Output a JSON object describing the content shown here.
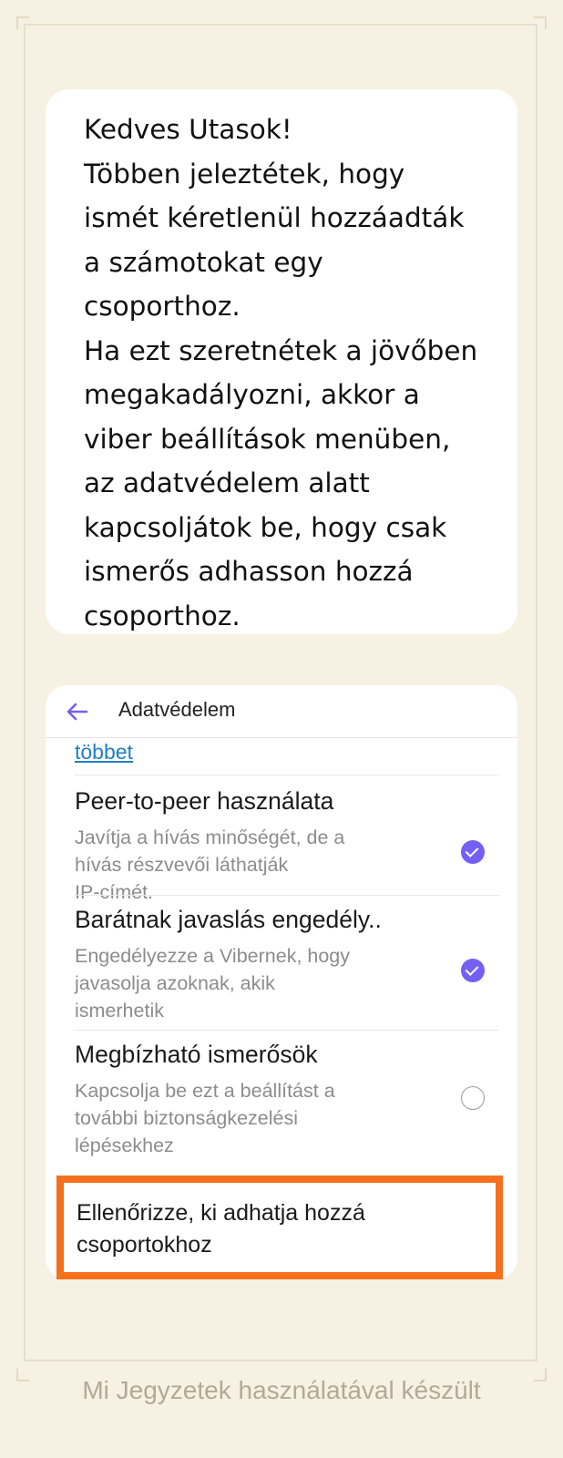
{
  "note": {
    "lines": [
      "Kedves Utasok!",
      "Többen jeleztétek, hogy",
      "ismét kéretlenül hozzáadták",
      "a számotokat egy",
      "csoporthoz.",
      "Ha ezt szeretnétek a jövőben",
      "megakadályozni, akkor a",
      "viber beállítások menüben,",
      "az adatvédelem alatt",
      "kapcsoljátok be, hogy csak",
      "ismerős adhasson hozzá",
      "csoporthoz."
    ]
  },
  "screenshot": {
    "title": "Adatvédelem",
    "more_link": "többet",
    "settings": [
      {
        "title": "Peer-to-peer használata",
        "desc_lines": [
          "Javítja a hívás minőségét, de a",
          "hívás részvevői láthatják",
          "IP-címét."
        ],
        "checked": true
      },
      {
        "title": "Barátnak javaslás engedély..",
        "desc_lines": [
          "Engedélyezze a Vibernek, hogy",
          "javasolja azoknak, akik",
          "ismerhetik"
        ],
        "checked": true
      },
      {
        "title": "Megbízható ismerősök",
        "desc_lines": [
          "Kapcsolja be ezt a beállítást a",
          "további biztonságkezelési",
          "lépésekhez"
        ],
        "checked": false
      }
    ],
    "highlighted_item": {
      "lines": [
        "Ellenőrizze, ki adhatja hozzá",
        "csoportokhoz"
      ]
    },
    "accent_color": "#7360f2",
    "highlight_color": "#f4701c"
  },
  "footer": "Mi Jegyzetek használatával készült"
}
